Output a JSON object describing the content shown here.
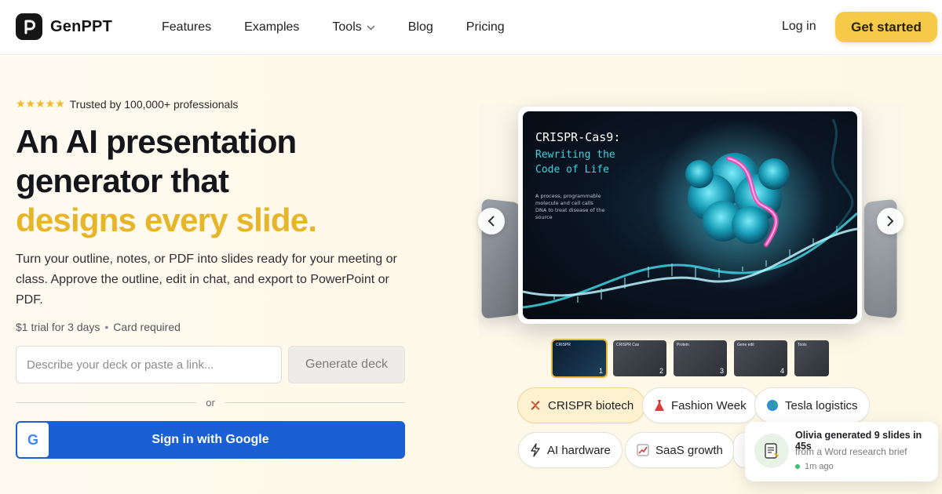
{
  "brand": {
    "name": "GenPPT"
  },
  "nav": {
    "links": [
      {
        "label": "Features"
      },
      {
        "label": "Examples"
      },
      {
        "label": "Tools"
      },
      {
        "label": "Blog"
      },
      {
        "label": "Pricing"
      }
    ],
    "login_label": "Log in",
    "cta_label": "Get started"
  },
  "hero": {
    "stars": "★★★★★",
    "trust": "Trusted by 100,000+ professionals",
    "headline_line1": "An AI presentation",
    "headline_line2": "generator that",
    "headline_accent": "designs every slide.",
    "subcopy": "Turn your outline, notes, or PDF into slides ready for your meeting or class. Approve the outline, edit in chat, and export to PowerPoint or PDF.",
    "trial": "$1 trial for 3 days",
    "card_required": "Card required",
    "input_placeholder": "Describe your deck or paste a link...",
    "generate_label": "Generate deck",
    "or_label": "or",
    "google_label": "Sign in with Google",
    "google_glyph": "G"
  },
  "slide": {
    "title": "CRISPR-Cas9:",
    "subtitle": "Rewriting the Code of Life",
    "description": "A process, programmable molecule and cell calls DNA to treat disease of the source"
  },
  "thumbnails": [
    {
      "num": "1",
      "label": "CRISPR"
    },
    {
      "num": "2",
      "label": "CRISPR Cas"
    },
    {
      "num": "3",
      "label": "Protein"
    },
    {
      "num": "4",
      "label": "Gene edit"
    },
    {
      "num": "",
      "label": "Tools"
    }
  ],
  "chips": [
    {
      "label": "CRISPR biotech",
      "icon": "dna-icon",
      "active": true
    },
    {
      "label": "Fashion Week",
      "icon": "dress-icon",
      "active": false
    },
    {
      "label": "Tesla logistics",
      "icon": "globe-icon",
      "active": false
    },
    {
      "label": "AI hardware",
      "icon": "lightning-icon",
      "active": false
    },
    {
      "label": "SaaS growth",
      "icon": "chart-icon",
      "active": false
    }
  ],
  "toast": {
    "title": "Olivia generated 9 slides in 45s",
    "subtitle": "from a Word research brief",
    "time": "1m ago",
    "icon": "document-icon"
  },
  "colors": {
    "accent_yellow": "#f7c948",
    "headline_accent": "#e7b52a",
    "google_blue": "#1a5fd4",
    "slide_cyan": "#3ed3e0"
  }
}
